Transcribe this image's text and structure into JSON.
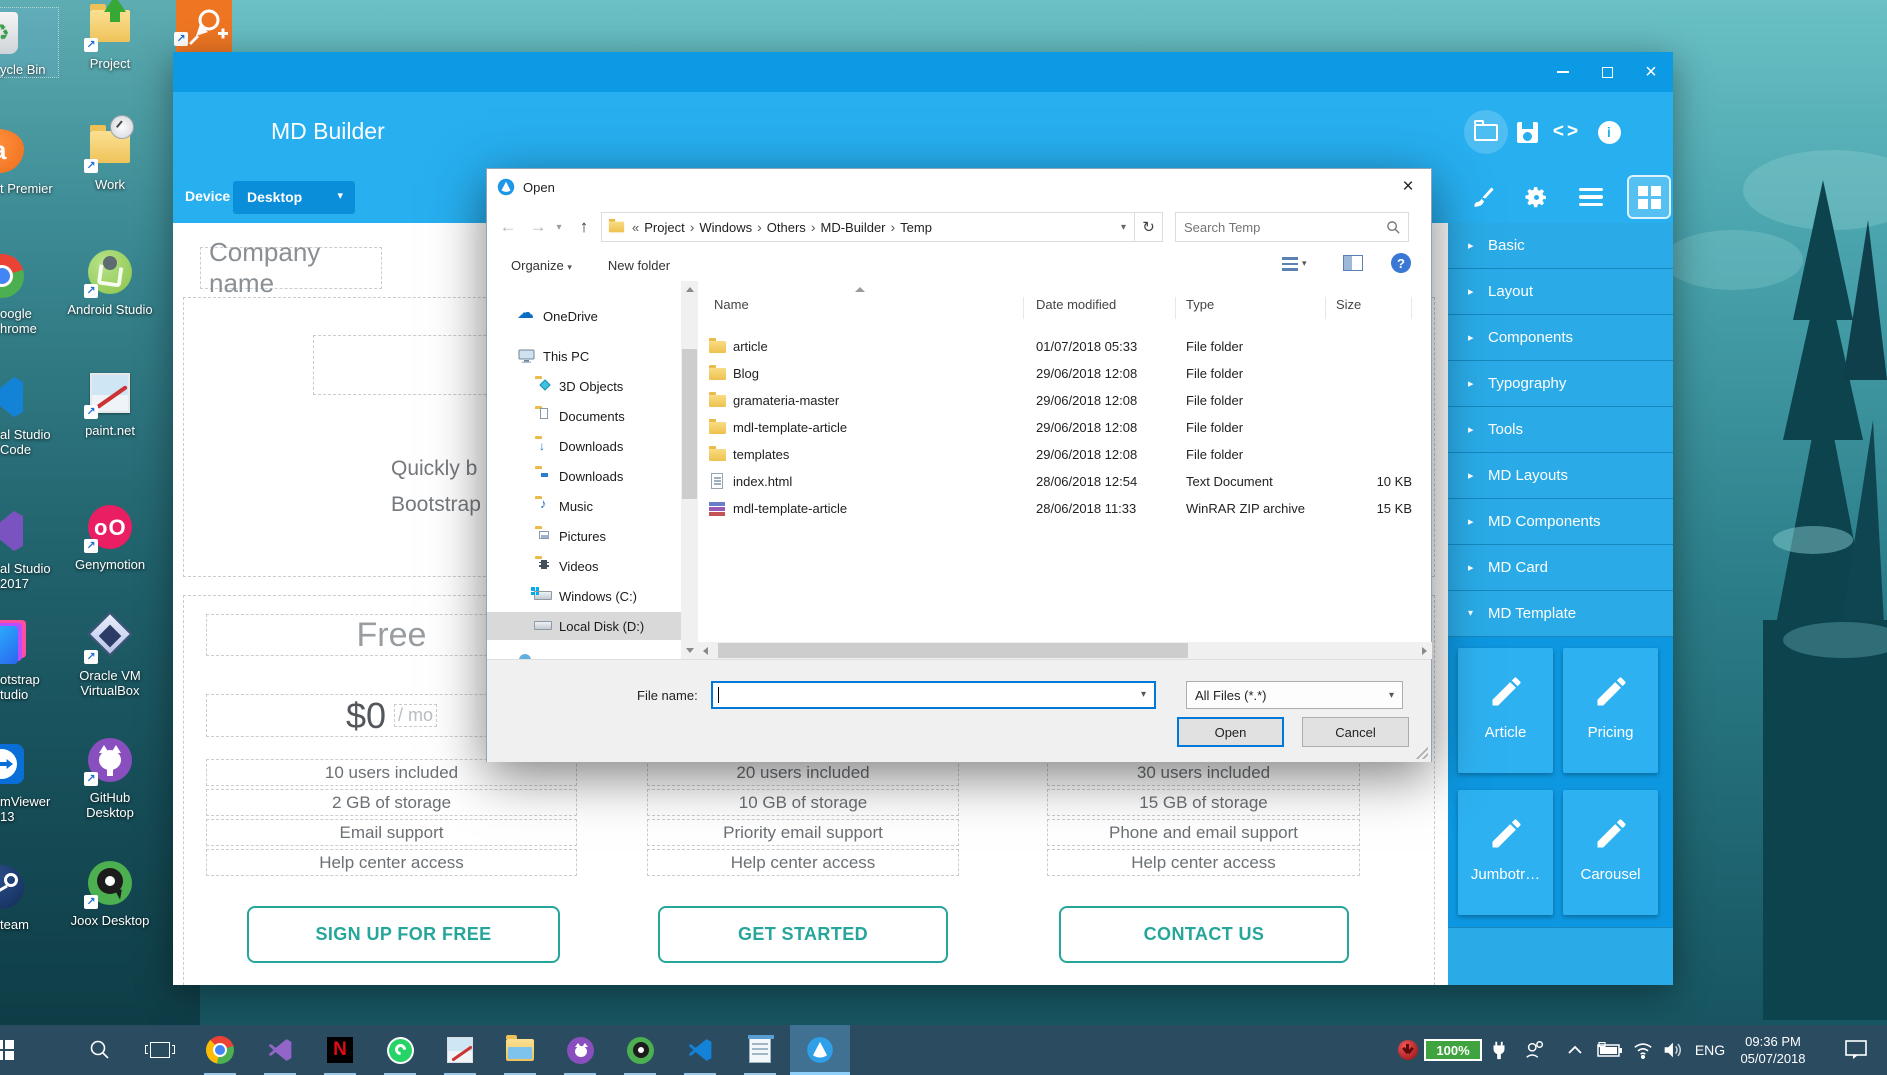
{
  "colors": {
    "titlebar": "#0c9ae4",
    "header": "#27aff0",
    "accent-dark": "#0a8ed9",
    "sidebar-item": "#2aabe7",
    "sidebar-sep": "#1687bf",
    "sidebar-panel": "#0d97e0",
    "card": "#2eb1f0",
    "teal": "#26a69a",
    "dash": "#c9cdd1",
    "taskbar": "#2b4b61",
    "taskbar-active": "#417192",
    "focus": "#0078d7"
  },
  "glyphs": {
    "prefix": "«",
    "sep": "›",
    "caret": "▾",
    "caret_r": "▸",
    "back": "←",
    "forward": "→",
    "up": "↑",
    "refresh": "↻",
    "close": "×",
    "music": "♪",
    "cloud": "☁",
    "recycle": "♻",
    "code": "<>",
    "info": "i",
    "help": "?",
    "shortcut": "↗",
    "n": "N"
  },
  "desktop": {
    "icons": [
      {
        "label": "ycle Bin"
      },
      {
        "label": "Project"
      },
      {
        "label": "t Premier"
      },
      {
        "label": "Work"
      },
      {
        "label": "oogle hrome"
      },
      {
        "label": "Android Studio"
      },
      {
        "label": "al Studio Code"
      },
      {
        "label": "paint.net"
      },
      {
        "label": "al Studio 2017"
      },
      {
        "label": "Genymotion"
      },
      {
        "label": "otstrap tudio"
      },
      {
        "label": "Oracle VM VirtualBox"
      },
      {
        "label": "mViewer 13"
      },
      {
        "label": "GitHub Desktop"
      },
      {
        "label": "team"
      },
      {
        "label": "Joox Desktop"
      }
    ]
  },
  "builder": {
    "title": "MD Builder",
    "device_label": "Device",
    "device_value": "Desktop",
    "sections": [
      "Basic",
      "Layout",
      "Components",
      "Typography",
      "Tools",
      "MD Layouts",
      "MD Components",
      "MD Card",
      "MD Template"
    ],
    "templates": [
      "Article",
      "Pricing",
      "Jumbotr…",
      "Carousel"
    ],
    "canvas": {
      "company": "Company name",
      "desc_line1": "Quickly b",
      "desc_line2": "Bootstrap",
      "plans": [
        {
          "title": "Free",
          "price": "$0",
          "per": "/ mo",
          "features": [
            "10 users included",
            "2 GB of storage",
            "Email support",
            "Help center access"
          ],
          "button": "SIGN UP FOR FREE"
        },
        {
          "features": [
            "20 users included",
            "10 GB of storage",
            "Priority email support",
            "Help center access"
          ],
          "button": "GET STARTED"
        },
        {
          "features": [
            "30 users included",
            "15 GB of storage",
            "Phone and email support",
            "Help center access"
          ],
          "button": "CONTACT US"
        }
      ]
    }
  },
  "dialog": {
    "title": "Open",
    "breadcrumb": [
      "Project",
      "Windows",
      "Others",
      "MD-Builder",
      "Temp"
    ],
    "search_placeholder": "Search Temp",
    "organize": "Organize",
    "new_folder": "New folder",
    "columns": [
      "Name",
      "Date modified",
      "Type",
      "Size"
    ],
    "nav": [
      "OneDrive",
      "This PC",
      "3D Objects",
      "Documents",
      "Downloads",
      "Downloads",
      "Music",
      "Pictures",
      "Videos",
      "Windows (C:)",
      "Local Disk (D:)"
    ],
    "files": [
      {
        "name": "article",
        "modified": "01/07/2018 05:33",
        "type": "File folder",
        "size": ""
      },
      {
        "name": "Blog",
        "modified": "29/06/2018 12:08",
        "type": "File folder",
        "size": ""
      },
      {
        "name": "gramateria-master",
        "modified": "29/06/2018 12:08",
        "type": "File folder",
        "size": ""
      },
      {
        "name": "mdl-template-article",
        "modified": "29/06/2018 12:08",
        "type": "File folder",
        "size": ""
      },
      {
        "name": "templates",
        "modified": "29/06/2018 12:08",
        "type": "File folder",
        "size": ""
      },
      {
        "name": "index.html",
        "modified": "28/06/2018 12:54",
        "type": "Text Document",
        "size": "10 KB"
      },
      {
        "name": "mdl-template-article",
        "modified": "28/06/2018 11:33",
        "type": "WinRAR ZIP archive",
        "size": "15 KB"
      }
    ],
    "file_name_label": "File name:",
    "file_type": "All Files (*.*)",
    "open": "Open",
    "cancel": "Cancel"
  },
  "taskbar": {
    "battery_pct": "100%",
    "lang": "ENG",
    "time": "09:36 PM",
    "date": "05/07/2018"
  }
}
